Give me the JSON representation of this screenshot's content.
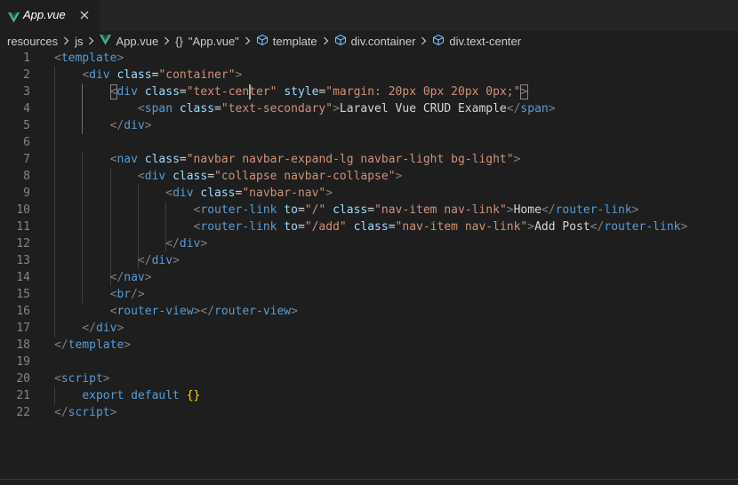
{
  "tab": {
    "title": "App.vue",
    "close_symbol": "✕",
    "accent_color": "#41b883"
  },
  "breadcrumbs": {
    "items": [
      "resources",
      "js",
      "App.vue",
      "\"App.vue\"",
      "template",
      "div.container",
      "div.text-center"
    ],
    "braces_symbol": "{}"
  },
  "editor": {
    "line_numbers": [
      "1",
      "2",
      "3",
      "4",
      "5",
      "6",
      "7",
      "8",
      "9",
      "10",
      "11",
      "12",
      "13",
      "14",
      "15",
      "16",
      "17",
      "18",
      "19",
      "20",
      "21",
      "22"
    ],
    "colors": {
      "tag": "#569cd6",
      "attribute": "#9cdcfe",
      "string": "#ce9178",
      "text": "#d4d4d4",
      "punctuation": "#808080",
      "brace": "#ffd700"
    },
    "lines": [
      [
        [
          "p",
          "<"
        ],
        [
          "tag",
          "template"
        ],
        [
          "p",
          ">"
        ]
      ],
      [
        [
          "ws",
          "    "
        ],
        [
          "p",
          "<"
        ],
        [
          "tag",
          "div"
        ],
        [
          "ws",
          " "
        ],
        [
          "attr",
          "class"
        ],
        [
          "text",
          "="
        ],
        [
          "str",
          "\"container\""
        ],
        [
          "p",
          ">"
        ]
      ],
      [
        [
          "ws",
          "        "
        ],
        [
          "p",
          "<"
        ],
        [
          "tag",
          "div"
        ],
        [
          "ws",
          " "
        ],
        [
          "attr",
          "class"
        ],
        [
          "text",
          "="
        ],
        [
          "str",
          "\"text-center\""
        ],
        [
          "ws",
          " "
        ],
        [
          "attr",
          "style"
        ],
        [
          "text",
          "="
        ],
        [
          "str",
          "\"margin: 20px 0px 20px 0px;\""
        ],
        [
          "p",
          ">"
        ]
      ],
      [
        [
          "ws",
          "            "
        ],
        [
          "p",
          "<"
        ],
        [
          "tag",
          "span"
        ],
        [
          "ws",
          " "
        ],
        [
          "attr",
          "class"
        ],
        [
          "text",
          "="
        ],
        [
          "str",
          "\"text-secondary\""
        ],
        [
          "p",
          ">"
        ],
        [
          "text",
          "Laravel Vue CRUD Example"
        ],
        [
          "p",
          "</"
        ],
        [
          "tag",
          "span"
        ],
        [
          "p",
          ">"
        ]
      ],
      [
        [
          "p",
          "        </"
        ],
        [
          "tag",
          "div"
        ],
        [
          "p",
          ">"
        ]
      ],
      [],
      [
        [
          "ws",
          "        "
        ],
        [
          "p",
          "<"
        ],
        [
          "tag",
          "nav"
        ],
        [
          "ws",
          " "
        ],
        [
          "attr",
          "class"
        ],
        [
          "text",
          "="
        ],
        [
          "str",
          "\"navbar navbar-expand-lg navbar-light bg-light\""
        ],
        [
          "p",
          ">"
        ]
      ],
      [
        [
          "ws",
          "            "
        ],
        [
          "p",
          "<"
        ],
        [
          "tag",
          "div"
        ],
        [
          "ws",
          " "
        ],
        [
          "attr",
          "class"
        ],
        [
          "text",
          "="
        ],
        [
          "str",
          "\"collapse navbar-collapse\""
        ],
        [
          "p",
          ">"
        ]
      ],
      [
        [
          "ws",
          "                "
        ],
        [
          "p",
          "<"
        ],
        [
          "tag",
          "div"
        ],
        [
          "ws",
          " "
        ],
        [
          "attr",
          "class"
        ],
        [
          "text",
          "="
        ],
        [
          "str",
          "\"navbar-nav\""
        ],
        [
          "p",
          ">"
        ]
      ],
      [
        [
          "ws",
          "                    "
        ],
        [
          "p",
          "<"
        ],
        [
          "tag",
          "router-link"
        ],
        [
          "ws",
          " "
        ],
        [
          "attr",
          "to"
        ],
        [
          "text",
          "="
        ],
        [
          "str",
          "\"/\""
        ],
        [
          "ws",
          " "
        ],
        [
          "attr",
          "class"
        ],
        [
          "text",
          "="
        ],
        [
          "str",
          "\"nav-item nav-link\""
        ],
        [
          "p",
          ">"
        ],
        [
          "text",
          "Home"
        ],
        [
          "p",
          "</"
        ],
        [
          "tag",
          "router-link"
        ],
        [
          "p",
          ">"
        ]
      ],
      [
        [
          "ws",
          "                    "
        ],
        [
          "p",
          "<"
        ],
        [
          "tag",
          "router-link"
        ],
        [
          "ws",
          " "
        ],
        [
          "attr",
          "to"
        ],
        [
          "text",
          "="
        ],
        [
          "str",
          "\"/add\""
        ],
        [
          "ws",
          " "
        ],
        [
          "attr",
          "class"
        ],
        [
          "text",
          "="
        ],
        [
          "str",
          "\"nav-item nav-link\""
        ],
        [
          "p",
          ">"
        ],
        [
          "text",
          "Add Post"
        ],
        [
          "p",
          "</"
        ],
        [
          "tag",
          "router-link"
        ],
        [
          "p",
          ">"
        ]
      ],
      [
        [
          "p",
          "                </"
        ],
        [
          "tag",
          "div"
        ],
        [
          "p",
          ">"
        ]
      ],
      [
        [
          "p",
          "            </"
        ],
        [
          "tag",
          "div"
        ],
        [
          "p",
          ">"
        ]
      ],
      [
        [
          "p",
          "        </"
        ],
        [
          "tag",
          "nav"
        ],
        [
          "p",
          ">"
        ]
      ],
      [
        [
          "ws",
          "        "
        ],
        [
          "p",
          "<"
        ],
        [
          "tag",
          "br"
        ],
        [
          "p",
          "/>"
        ]
      ],
      [
        [
          "ws",
          "        "
        ],
        [
          "p",
          "<"
        ],
        [
          "tag",
          "router-view"
        ],
        [
          "p",
          "></"
        ],
        [
          "tag",
          "router-view"
        ],
        [
          "p",
          ">"
        ]
      ],
      [
        [
          "p",
          "    </"
        ],
        [
          "tag",
          "div"
        ],
        [
          "p",
          ">"
        ]
      ],
      [
        [
          "p",
          "</"
        ],
        [
          "tag",
          "template"
        ],
        [
          "p",
          ">"
        ]
      ],
      [],
      [
        [
          "p",
          "<"
        ],
        [
          "tag",
          "script"
        ],
        [
          "p",
          ">"
        ]
      ],
      [
        [
          "ws",
          "    "
        ],
        [
          "tag",
          "export default"
        ],
        [
          "ws",
          " "
        ],
        [
          "brace",
          "{}"
        ]
      ],
      [
        [
          "p",
          "</"
        ],
        [
          "tag",
          "script"
        ],
        [
          "p",
          ">"
        ]
      ]
    ]
  }
}
